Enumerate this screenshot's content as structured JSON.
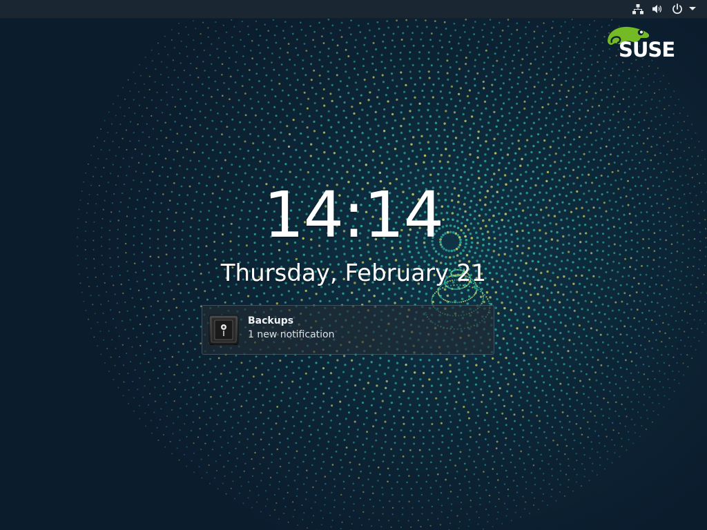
{
  "screen": {
    "type": "lock-screen"
  },
  "top_bar": {
    "icons": [
      "network-wired-icon",
      "volume-icon",
      "power-icon",
      "menu-arrow-icon"
    ]
  },
  "logo": {
    "text": "SUSE",
    "brand_color": "#73ba25"
  },
  "clock": {
    "time": "14:14",
    "date": "Thursday, February 21"
  },
  "notification": {
    "icon": "safe-icon",
    "title": "Backups",
    "body": "1 new notification"
  },
  "colors": {
    "background": "#0b1c2d",
    "topbar": "#1a2632",
    "dot_teal": "#2fb5a3",
    "dot_yellow": "#c9d96a"
  }
}
